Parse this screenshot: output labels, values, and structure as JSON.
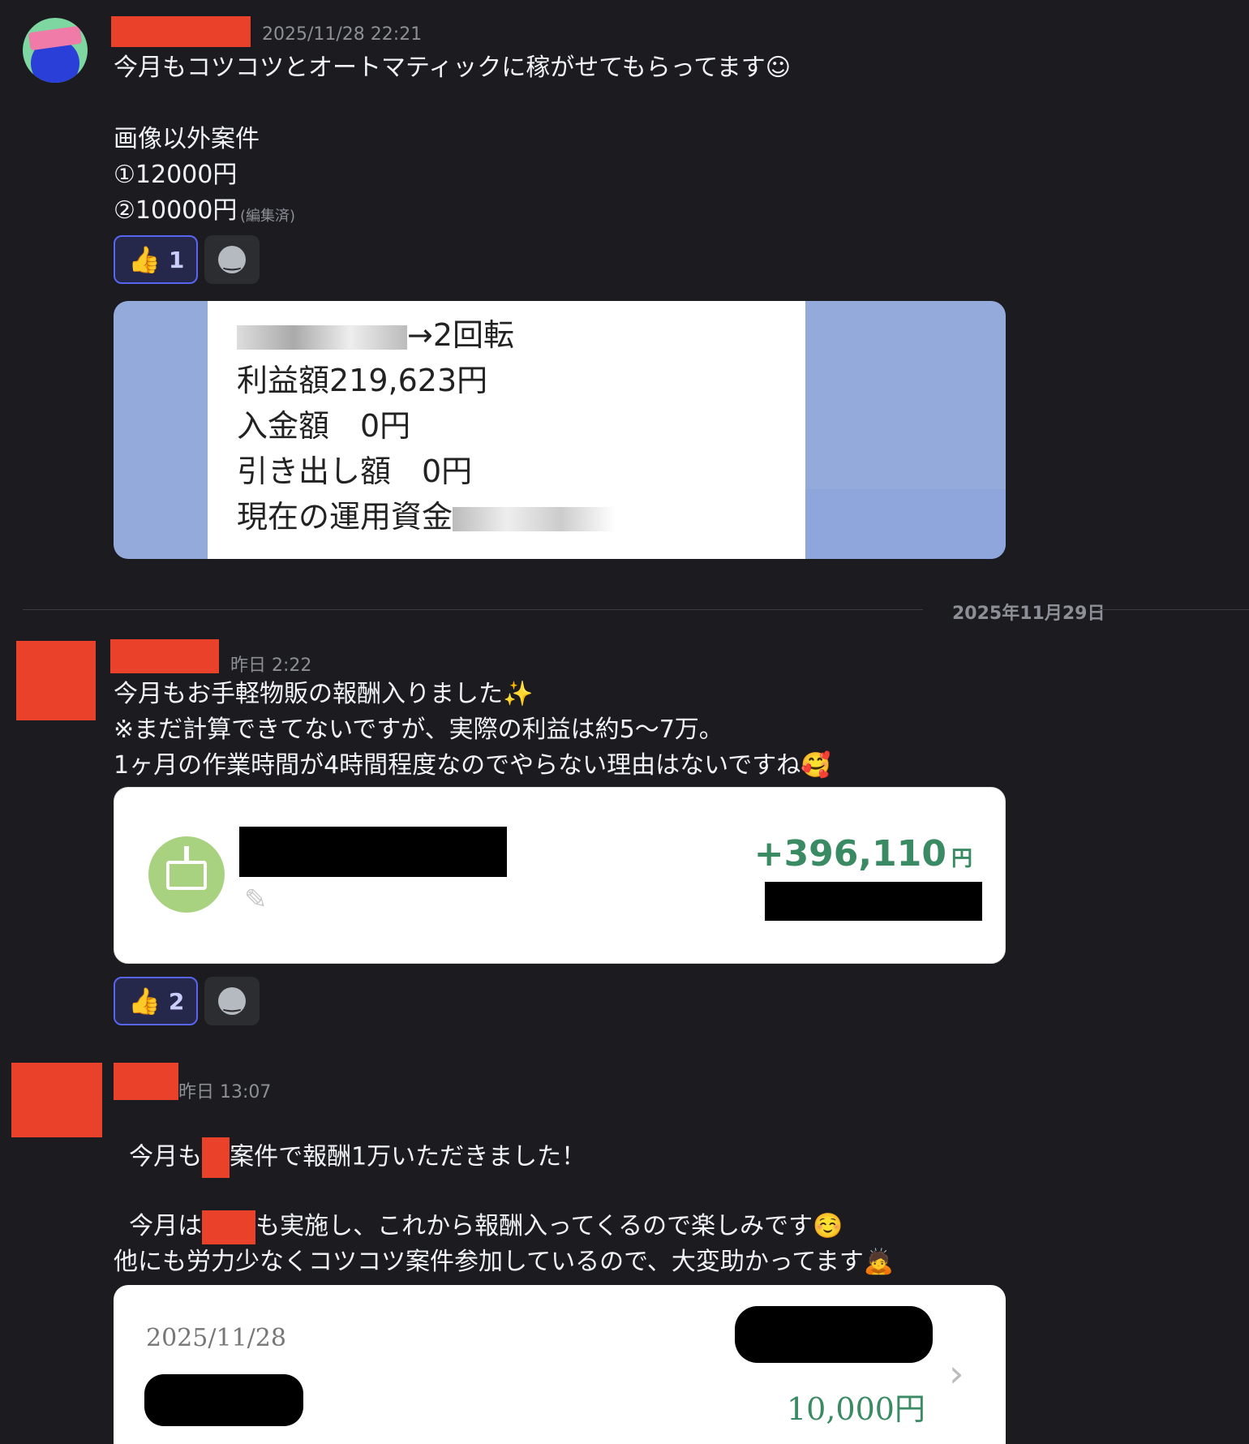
{
  "messages": [
    {
      "timestamp": "2025/11/28 22:21",
      "lines": [
        "今月もコツコツとオートマティックに稼がせてもらってます☺"
      ],
      "lines2": [
        "画像以外案件",
        "①12000円"
      ],
      "last_line": "②10000円",
      "edited": "(編集済)",
      "reactions": {
        "count": "1",
        "emoji": "👍"
      },
      "image_lines": [
        "→2回転",
        "利益額219,623円",
        "入金額　0円",
        "引き出し額　0円",
        "現在の運用資金"
      ]
    },
    {
      "timestamp": "昨日 2:22",
      "lines": [
        "今月もお手軽物販の報酬入りました✨",
        "※まだ計算できてないですが、実際の利益は約5〜7万。",
        "1ヶ月の作業時間が4時間程度なのでやらない理由はないですね🥰"
      ],
      "card": {
        "amount": "+396,110",
        "currency": "円",
        "icon": "receive-card-icon"
      },
      "reactions": {
        "count": "2",
        "emoji": "👍"
      }
    },
    {
      "timestamp": "昨日 13:07",
      "line1_a": "今月も",
      "line1_b": "案件で報酬1万いただきました！",
      "line2_a": "今月は",
      "line2_b": "も実施し、これから報酬入ってくるので楽しみです☺️",
      "line3": "他にも労力少なくコツコツ案件参加しているので、大変助かってます🙇",
      "card": {
        "date": "2025/11/28",
        "amount": "10,000円"
      }
    }
  ],
  "date_divider": "2025年11月29日",
  "colors": {
    "background": "#1b1b20",
    "redaction": "#e9412a",
    "accent": "#5865f2",
    "positive": "#3a8a64"
  }
}
